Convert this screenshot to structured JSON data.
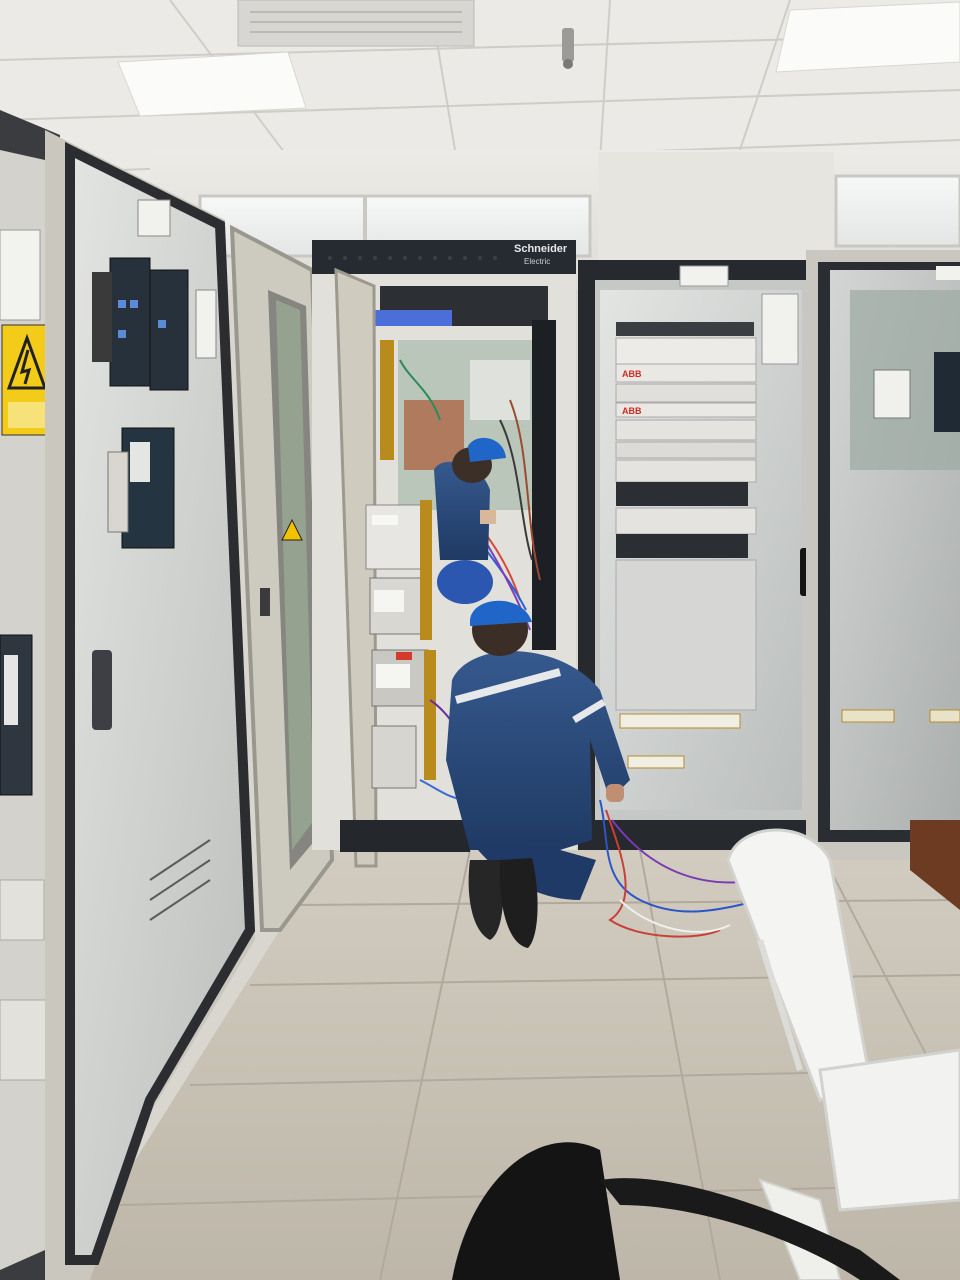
{
  "scene": {
    "brand_text": "Schneider",
    "brand_sub": "Electric",
    "rack_brand_1": "ABB",
    "rack_brand_2": "ABB",
    "colors": {
      "ceiling": "#e9e8e4",
      "floor": "#c9c3b7",
      "cabinet_grey": "#cfccc4",
      "cabinet_dark": "#2b2d31",
      "workwear_blue": "#2c4a78",
      "helmet_blue": "#1f5fb8",
      "warning_yellow": "#f2c200",
      "chair_white": "#f4f4f2",
      "chair_black": "#141414"
    },
    "icons": [
      "warning-triangle-icon",
      "ceiling-light-icon",
      "smoke-detector-icon"
    ]
  }
}
